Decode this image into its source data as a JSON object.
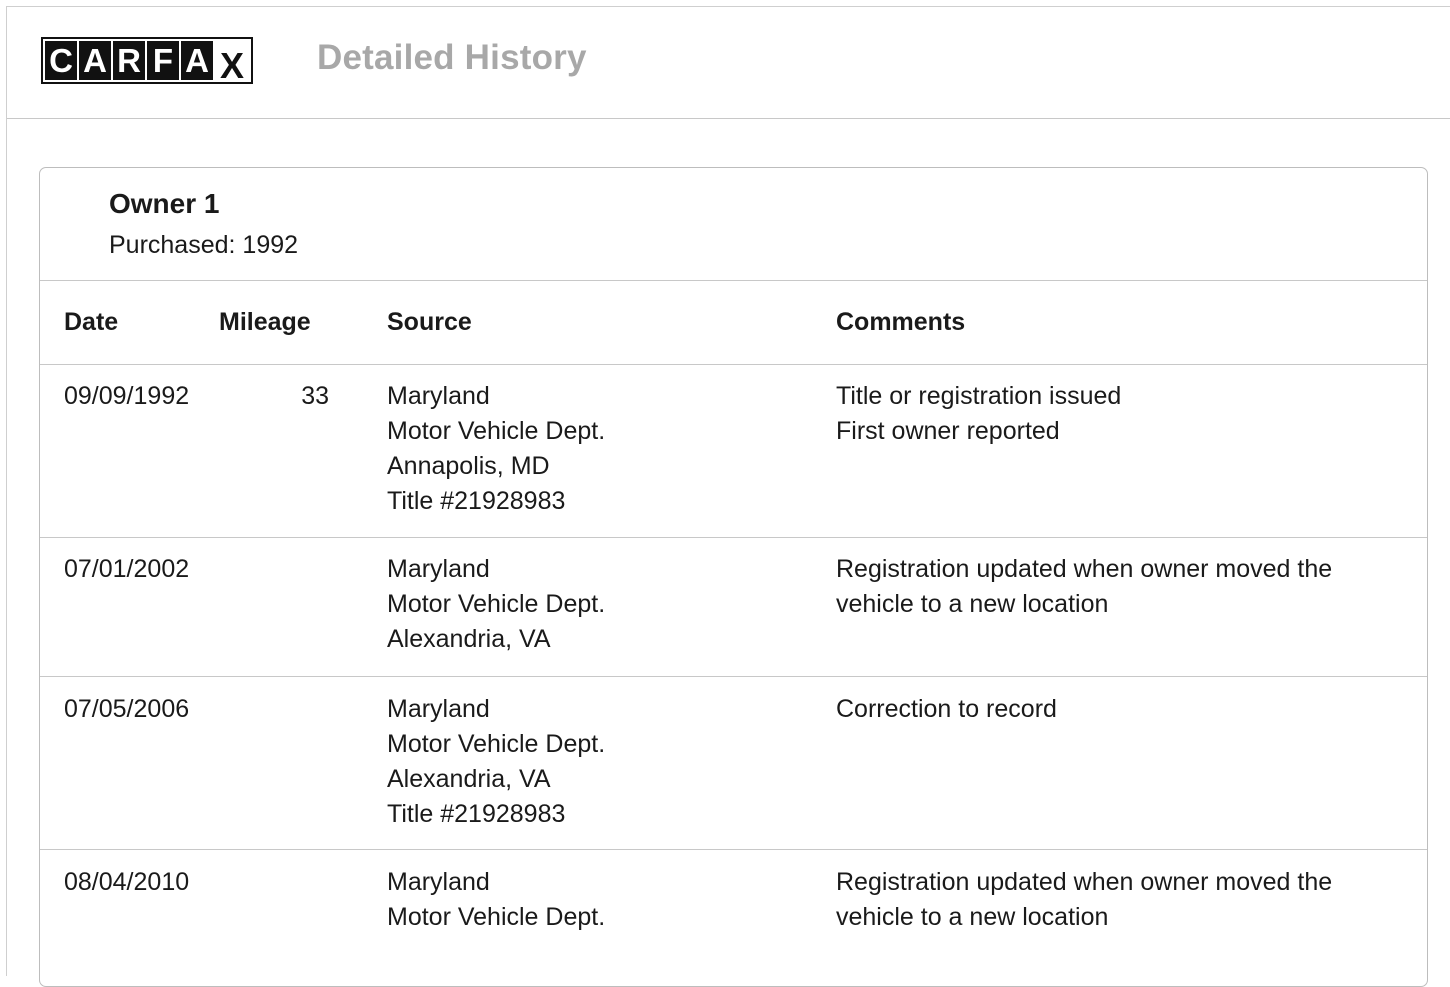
{
  "header": {
    "logo_letters": [
      "C",
      "A",
      "R",
      "F",
      "A",
      "X"
    ],
    "title": "Detailed History"
  },
  "owner": {
    "title": "Owner 1",
    "purchased": "Purchased: 1992"
  },
  "table": {
    "columns": [
      "Date",
      "Mileage",
      "Source",
      "Comments"
    ],
    "rows": [
      {
        "date": "09/09/1992",
        "mileage": "33",
        "source": [
          "Maryland",
          "Motor Vehicle Dept.",
          "Annapolis, MD",
          "Title #21928983"
        ],
        "comments": [
          "Title or registration issued",
          "First owner reported"
        ]
      },
      {
        "date": "07/01/2002",
        "mileage": "",
        "source": [
          "Maryland",
          "Motor Vehicle Dept.",
          "Alexandria, VA"
        ],
        "comments": [
          "Registration updated when owner moved the",
          "vehicle to a new location"
        ]
      },
      {
        "date": "07/05/2006",
        "mileage": "",
        "source": [
          "Maryland",
          "Motor Vehicle Dept.",
          "Alexandria, VA",
          "Title #21928983"
        ],
        "comments": [
          "Correction to record"
        ]
      },
      {
        "date": "08/04/2010",
        "mileage": "",
        "source": [
          "Maryland",
          "Motor Vehicle Dept."
        ],
        "comments": [
          "Registration updated when owner moved the",
          "vehicle to a new location"
        ]
      }
    ]
  }
}
